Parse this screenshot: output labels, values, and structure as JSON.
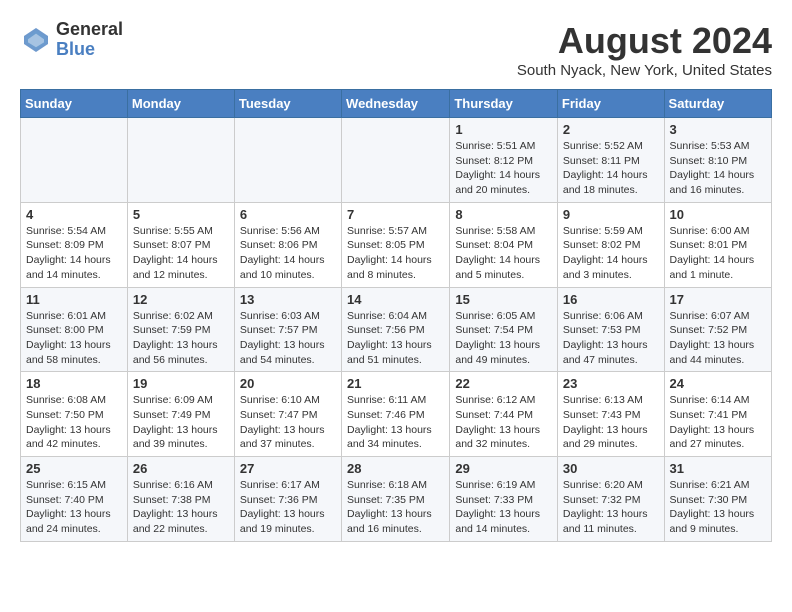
{
  "header": {
    "logo_line1": "General",
    "logo_line2": "Blue",
    "title": "August 2024",
    "subtitle": "South Nyack, New York, United States"
  },
  "days_of_week": [
    "Sunday",
    "Monday",
    "Tuesday",
    "Wednesday",
    "Thursday",
    "Friday",
    "Saturday"
  ],
  "weeks": [
    [
      {
        "day": "",
        "info": ""
      },
      {
        "day": "",
        "info": ""
      },
      {
        "day": "",
        "info": ""
      },
      {
        "day": "",
        "info": ""
      },
      {
        "day": "1",
        "info": "Sunrise: 5:51 AM\nSunset: 8:12 PM\nDaylight: 14 hours\nand 20 minutes."
      },
      {
        "day": "2",
        "info": "Sunrise: 5:52 AM\nSunset: 8:11 PM\nDaylight: 14 hours\nand 18 minutes."
      },
      {
        "day": "3",
        "info": "Sunrise: 5:53 AM\nSunset: 8:10 PM\nDaylight: 14 hours\nand 16 minutes."
      }
    ],
    [
      {
        "day": "4",
        "info": "Sunrise: 5:54 AM\nSunset: 8:09 PM\nDaylight: 14 hours\nand 14 minutes."
      },
      {
        "day": "5",
        "info": "Sunrise: 5:55 AM\nSunset: 8:07 PM\nDaylight: 14 hours\nand 12 minutes."
      },
      {
        "day": "6",
        "info": "Sunrise: 5:56 AM\nSunset: 8:06 PM\nDaylight: 14 hours\nand 10 minutes."
      },
      {
        "day": "7",
        "info": "Sunrise: 5:57 AM\nSunset: 8:05 PM\nDaylight: 14 hours\nand 8 minutes."
      },
      {
        "day": "8",
        "info": "Sunrise: 5:58 AM\nSunset: 8:04 PM\nDaylight: 14 hours\nand 5 minutes."
      },
      {
        "day": "9",
        "info": "Sunrise: 5:59 AM\nSunset: 8:02 PM\nDaylight: 14 hours\nand 3 minutes."
      },
      {
        "day": "10",
        "info": "Sunrise: 6:00 AM\nSunset: 8:01 PM\nDaylight: 14 hours\nand 1 minute."
      }
    ],
    [
      {
        "day": "11",
        "info": "Sunrise: 6:01 AM\nSunset: 8:00 PM\nDaylight: 13 hours\nand 58 minutes."
      },
      {
        "day": "12",
        "info": "Sunrise: 6:02 AM\nSunset: 7:59 PM\nDaylight: 13 hours\nand 56 minutes."
      },
      {
        "day": "13",
        "info": "Sunrise: 6:03 AM\nSunset: 7:57 PM\nDaylight: 13 hours\nand 54 minutes."
      },
      {
        "day": "14",
        "info": "Sunrise: 6:04 AM\nSunset: 7:56 PM\nDaylight: 13 hours\nand 51 minutes."
      },
      {
        "day": "15",
        "info": "Sunrise: 6:05 AM\nSunset: 7:54 PM\nDaylight: 13 hours\nand 49 minutes."
      },
      {
        "day": "16",
        "info": "Sunrise: 6:06 AM\nSunset: 7:53 PM\nDaylight: 13 hours\nand 47 minutes."
      },
      {
        "day": "17",
        "info": "Sunrise: 6:07 AM\nSunset: 7:52 PM\nDaylight: 13 hours\nand 44 minutes."
      }
    ],
    [
      {
        "day": "18",
        "info": "Sunrise: 6:08 AM\nSunset: 7:50 PM\nDaylight: 13 hours\nand 42 minutes."
      },
      {
        "day": "19",
        "info": "Sunrise: 6:09 AM\nSunset: 7:49 PM\nDaylight: 13 hours\nand 39 minutes."
      },
      {
        "day": "20",
        "info": "Sunrise: 6:10 AM\nSunset: 7:47 PM\nDaylight: 13 hours\nand 37 minutes."
      },
      {
        "day": "21",
        "info": "Sunrise: 6:11 AM\nSunset: 7:46 PM\nDaylight: 13 hours\nand 34 minutes."
      },
      {
        "day": "22",
        "info": "Sunrise: 6:12 AM\nSunset: 7:44 PM\nDaylight: 13 hours\nand 32 minutes."
      },
      {
        "day": "23",
        "info": "Sunrise: 6:13 AM\nSunset: 7:43 PM\nDaylight: 13 hours\nand 29 minutes."
      },
      {
        "day": "24",
        "info": "Sunrise: 6:14 AM\nSunset: 7:41 PM\nDaylight: 13 hours\nand 27 minutes."
      }
    ],
    [
      {
        "day": "25",
        "info": "Sunrise: 6:15 AM\nSunset: 7:40 PM\nDaylight: 13 hours\nand 24 minutes."
      },
      {
        "day": "26",
        "info": "Sunrise: 6:16 AM\nSunset: 7:38 PM\nDaylight: 13 hours\nand 22 minutes."
      },
      {
        "day": "27",
        "info": "Sunrise: 6:17 AM\nSunset: 7:36 PM\nDaylight: 13 hours\nand 19 minutes."
      },
      {
        "day": "28",
        "info": "Sunrise: 6:18 AM\nSunset: 7:35 PM\nDaylight: 13 hours\nand 16 minutes."
      },
      {
        "day": "29",
        "info": "Sunrise: 6:19 AM\nSunset: 7:33 PM\nDaylight: 13 hours\nand 14 minutes."
      },
      {
        "day": "30",
        "info": "Sunrise: 6:20 AM\nSunset: 7:32 PM\nDaylight: 13 hours\nand 11 minutes."
      },
      {
        "day": "31",
        "info": "Sunrise: 6:21 AM\nSunset: 7:30 PM\nDaylight: 13 hours\nand 9 minutes."
      }
    ]
  ]
}
